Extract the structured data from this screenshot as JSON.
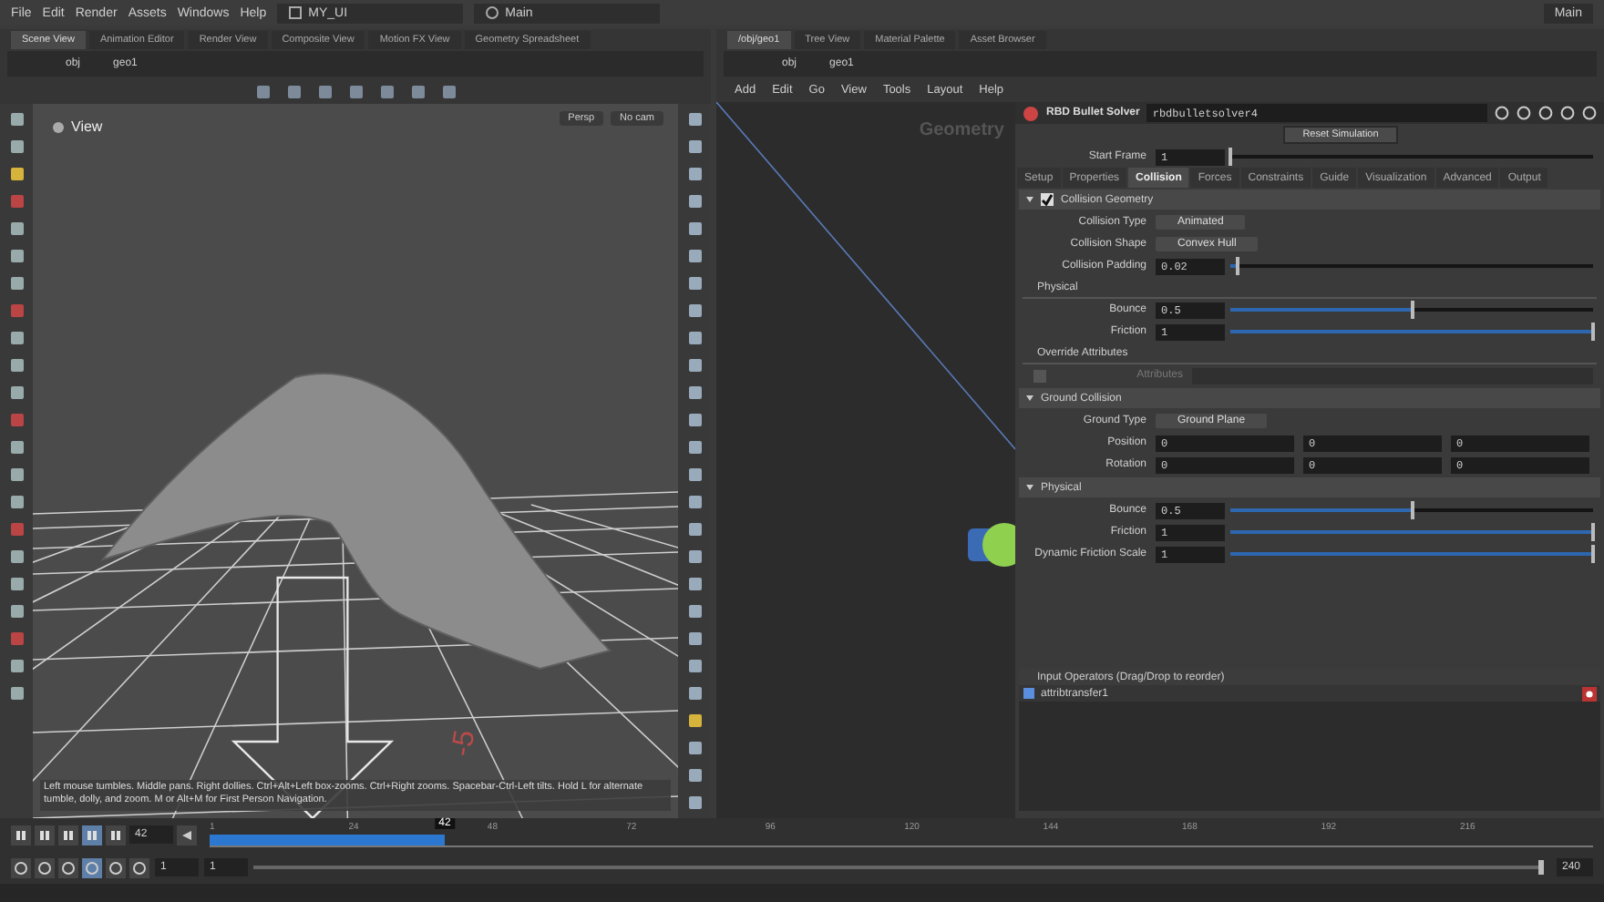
{
  "menu_bar": {
    "items": [
      "File",
      "Edit",
      "Render",
      "Assets",
      "Windows",
      "Help"
    ],
    "desktop": "MY_UI",
    "context": "Main",
    "right_context": "Main"
  },
  "scene_pane": {
    "tabs": [
      {
        "label": "Scene View",
        "selected": true
      },
      {
        "label": "Animation Editor",
        "selected": false
      },
      {
        "label": "Render View",
        "selected": false
      },
      {
        "label": "Composite View",
        "selected": false
      },
      {
        "label": "Motion FX View",
        "selected": false
      },
      {
        "label": "Geometry Spreadsheet",
        "selected": false
      }
    ],
    "path": [
      "obj",
      "geo1"
    ],
    "viewport": {
      "label": "View",
      "camera": "Persp",
      "cam_menu": "No cam",
      "grid_label": "-5",
      "status": "Left mouse tumbles. Middle pans. Right dollies. Ctrl+Alt+Left box-zooms. Ctrl+Right zooms. Spacebar-Ctrl-Left tilts. Hold L for alternate tumble, dolly, and zoom. M or Alt+M for First Person Navigation."
    }
  },
  "network_pane": {
    "tabs": [
      {
        "label": "/obj/geo1",
        "selected": true
      },
      {
        "label": "Tree View",
        "selected": false
      },
      {
        "label": "Material Palette",
        "selected": false
      },
      {
        "label": "Asset Browser",
        "selected": false
      }
    ],
    "path": [
      "obj",
      "geo1"
    ],
    "menu": [
      "Add",
      "Edit",
      "Go",
      "View",
      "Tools",
      "Layout",
      "Help"
    ],
    "label": "Geometry"
  },
  "parameters": {
    "node_type": "RBD Bullet Solver",
    "node_name": "rbdbulletsolver4",
    "reset_button": "Reset Simulation",
    "start_frame": {
      "label": "Start Frame",
      "value": "1",
      "level": 0
    },
    "tabs": [
      {
        "label": "Setup",
        "selected": false
      },
      {
        "label": "Properties",
        "selected": false
      },
      {
        "label": "Collision",
        "selected": true
      },
      {
        "label": "Forces",
        "selected": false
      },
      {
        "label": "Constraints",
        "selected": false
      },
      {
        "label": "Guide",
        "selected": false
      },
      {
        "label": "Visualization",
        "selected": false
      },
      {
        "label": "Advanced",
        "selected": false
      },
      {
        "label": "Output",
        "selected": false
      }
    ],
    "rows": [
      {
        "kind": "section",
        "title": "Collision Geometry",
        "expanded": true,
        "checked": true
      },
      {
        "kind": "dropdown",
        "label": "Collision Type",
        "value": "Animated"
      },
      {
        "kind": "dropdown",
        "label": "Collision Shape",
        "value": "Convex Hull"
      },
      {
        "kind": "slider",
        "label": "Collision Padding",
        "value": "0.02",
        "level": 0.02
      },
      {
        "kind": "heading",
        "label": "Physical"
      },
      {
        "kind": "slider",
        "label": "Bounce",
        "value": "0.5",
        "level": 0.5
      },
      {
        "kind": "slider",
        "label": "Friction",
        "value": "1",
        "level": 1
      },
      {
        "kind": "heading",
        "label": "Override Attributes"
      },
      {
        "kind": "attribute",
        "label": "Attributes",
        "checked": false,
        "disabled": true
      },
      {
        "kind": "section",
        "title": "Ground Collision",
        "expanded": true
      },
      {
        "kind": "dropdown",
        "label": "Ground Type",
        "value": "Ground Plane"
      },
      {
        "kind": "vector",
        "label": "Position",
        "values": [
          "0",
          "0",
          "0"
        ]
      },
      {
        "kind": "vector",
        "label": "Rotation",
        "values": [
          "0",
          "0",
          "0"
        ]
      },
      {
        "kind": "section",
        "title": "Physical",
        "expanded": true
      },
      {
        "kind": "slider",
        "label": "Bounce",
        "value": "0.5",
        "level": 0.5
      },
      {
        "kind": "slider",
        "label": "Friction",
        "value": "1",
        "level": 1
      },
      {
        "kind": "slider",
        "label": "Dynamic Friction Scale",
        "value": "1",
        "level": 1
      }
    ],
    "input_operators": {
      "title": "Input Operators (Drag/Drop to reorder)",
      "items": [
        "attribtransfer1"
      ]
    }
  },
  "timeline": {
    "frame": "42",
    "marker": "42",
    "level": 0.17,
    "ticks": [
      "1",
      "24",
      "48",
      "72",
      "96",
      "120",
      "144",
      "168",
      "192",
      "216"
    ],
    "start": "1",
    "start_2": "1",
    "end": "240",
    "range": {
      "level": 1
    }
  }
}
